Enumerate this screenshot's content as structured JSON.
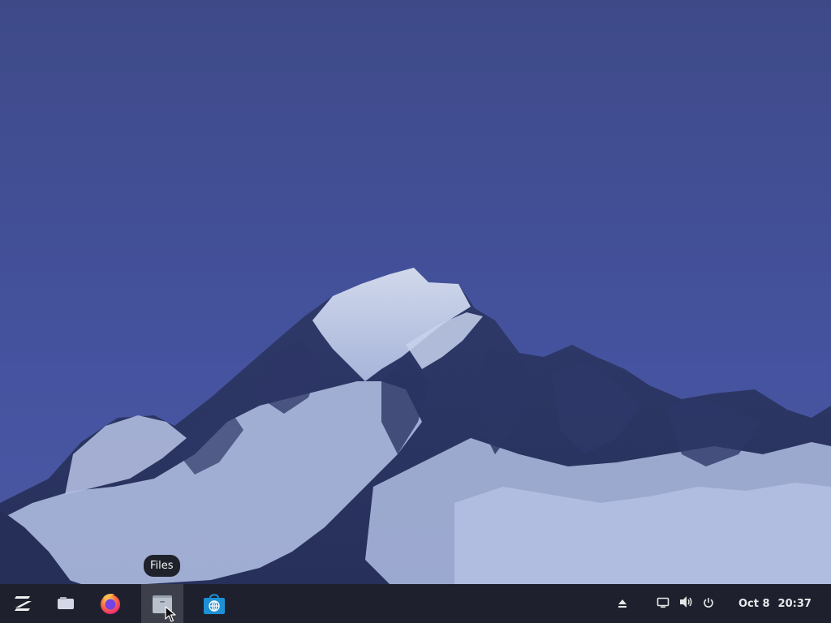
{
  "taskbar": {
    "launchers": [
      {
        "name": "zorin-menu",
        "icon": "zorin-logo-icon"
      },
      {
        "name": "workspaces",
        "icon": "workspace-switcher-icon"
      },
      {
        "name": "firefox",
        "icon": "firefox-icon"
      },
      {
        "name": "files",
        "icon": "files-icon",
        "tooltip": "Files",
        "hovered": true
      },
      {
        "name": "software",
        "icon": "software-store-icon"
      }
    ],
    "tray": [
      "eject-icon",
      "screen-icon",
      "volume-icon",
      "power-icon"
    ],
    "clock": {
      "date": "Oct 8",
      "time": "20:37"
    }
  },
  "tooltip": {
    "text": "Files"
  },
  "colors": {
    "sky": "#44529a",
    "taskbar": "#1c1f28",
    "tooltip_bg": "#1f222b",
    "store_blue": "#1e90d6",
    "firefox_orange": "#ff7139"
  }
}
